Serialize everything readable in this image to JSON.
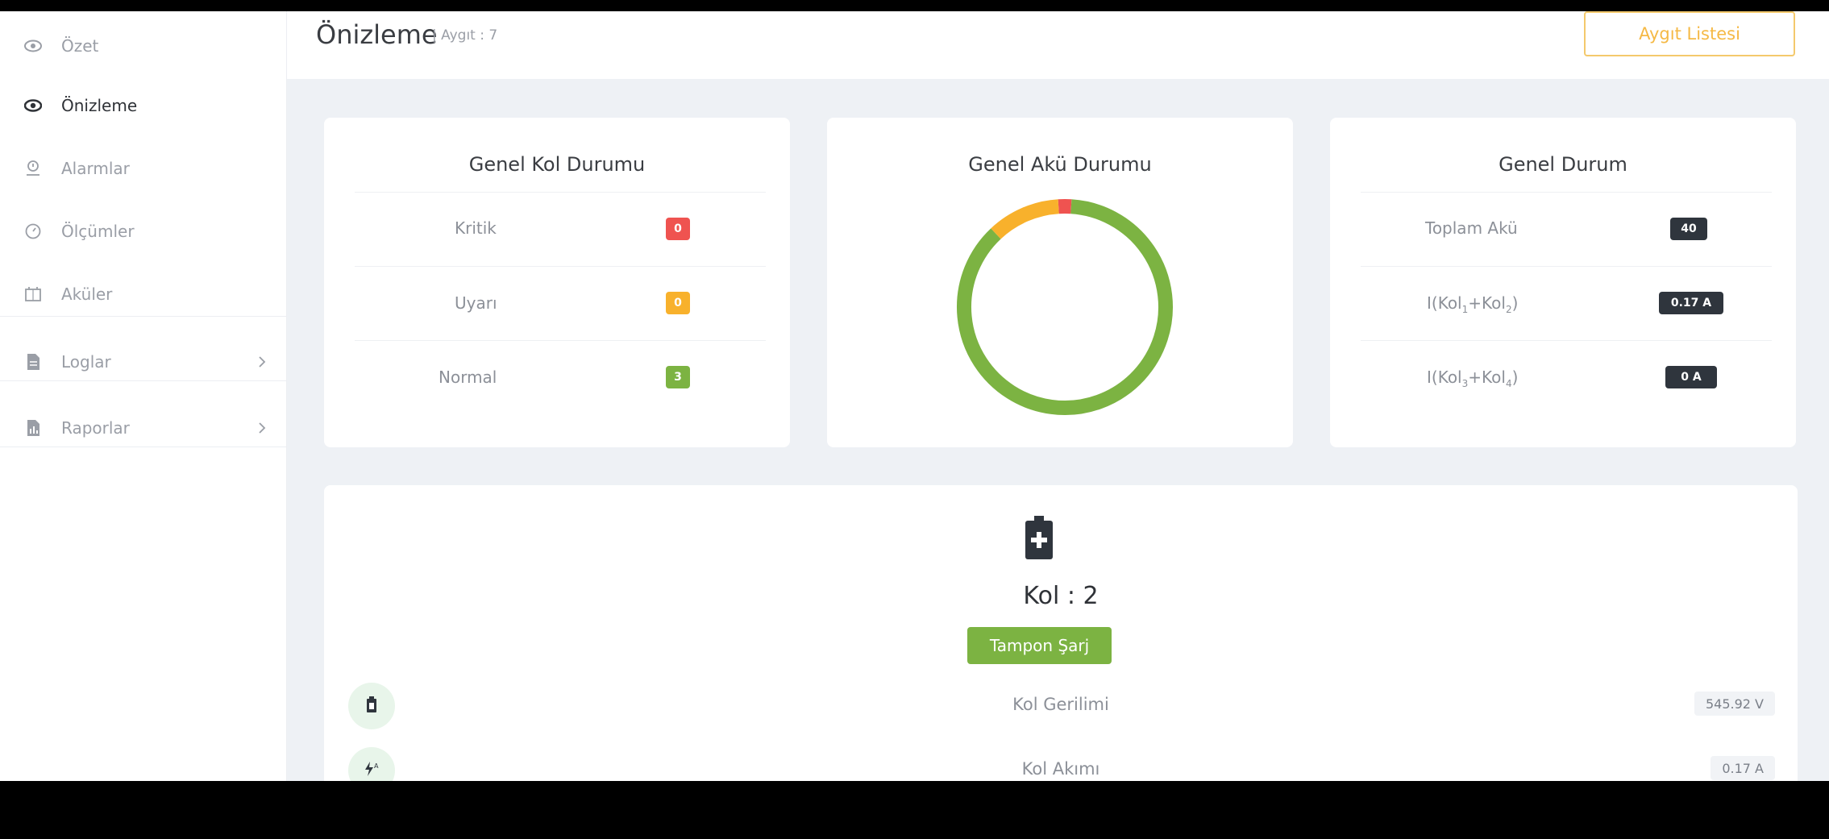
{
  "sidebar": {
    "items": [
      {
        "label": "Özet",
        "icon": "eye-icon"
      },
      {
        "label": "Önizleme",
        "icon": "eye-icon",
        "active": true
      },
      {
        "label": "Alarmlar",
        "icon": "alarm-icon"
      },
      {
        "label": "Ölçümler",
        "icon": "gauge-icon"
      },
      {
        "label": "Aküler",
        "icon": "battery-pack-icon"
      },
      {
        "label": "Loglar",
        "icon": "document-icon",
        "expandable": true
      },
      {
        "label": "Raporlar",
        "icon": "report-icon",
        "expandable": true
      }
    ]
  },
  "header": {
    "title": "Önizleme",
    "subtitle": "| Aygıt : 7",
    "device_list_button": "Aygıt Listesi"
  },
  "cards": {
    "column_status": {
      "title": "Genel Kol Durumu",
      "rows": [
        {
          "label": "Kritik",
          "value": "0",
          "color": "#ef5350"
        },
        {
          "label": "Uyarı",
          "value": "0",
          "color": "#f8b12c"
        },
        {
          "label": "Normal",
          "value": "3",
          "color": "#7cb342"
        }
      ]
    },
    "battery_status": {
      "title": "Genel Akü Durumu"
    },
    "general_status": {
      "title": "Genel Durum",
      "rows": [
        {
          "label": "Toplam Akü",
          "value": "40"
        },
        {
          "label": "I(Kol1+Kol2)",
          "value": "0.17 A"
        },
        {
          "label": "I(Kol3+Kol4)",
          "value": "0 A"
        }
      ]
    }
  },
  "column_detail": {
    "title": "Kol : 2",
    "status_button": "Tampon Şarj",
    "metrics": [
      {
        "label": "Kol Gerilimi",
        "value": "545.92 V",
        "icon": "battery-icon"
      },
      {
        "label": "Kol Akımı",
        "value": "0.17 A",
        "icon": "current-icon"
      }
    ]
  },
  "chart_data": {
    "type": "pie",
    "categories": [
      "Normal",
      "Uyarı",
      "Kritik"
    ],
    "values": [
      87,
      11,
      2
    ],
    "colors": [
      "#7cb342",
      "#f8b12c",
      "#ef5350"
    ]
  }
}
